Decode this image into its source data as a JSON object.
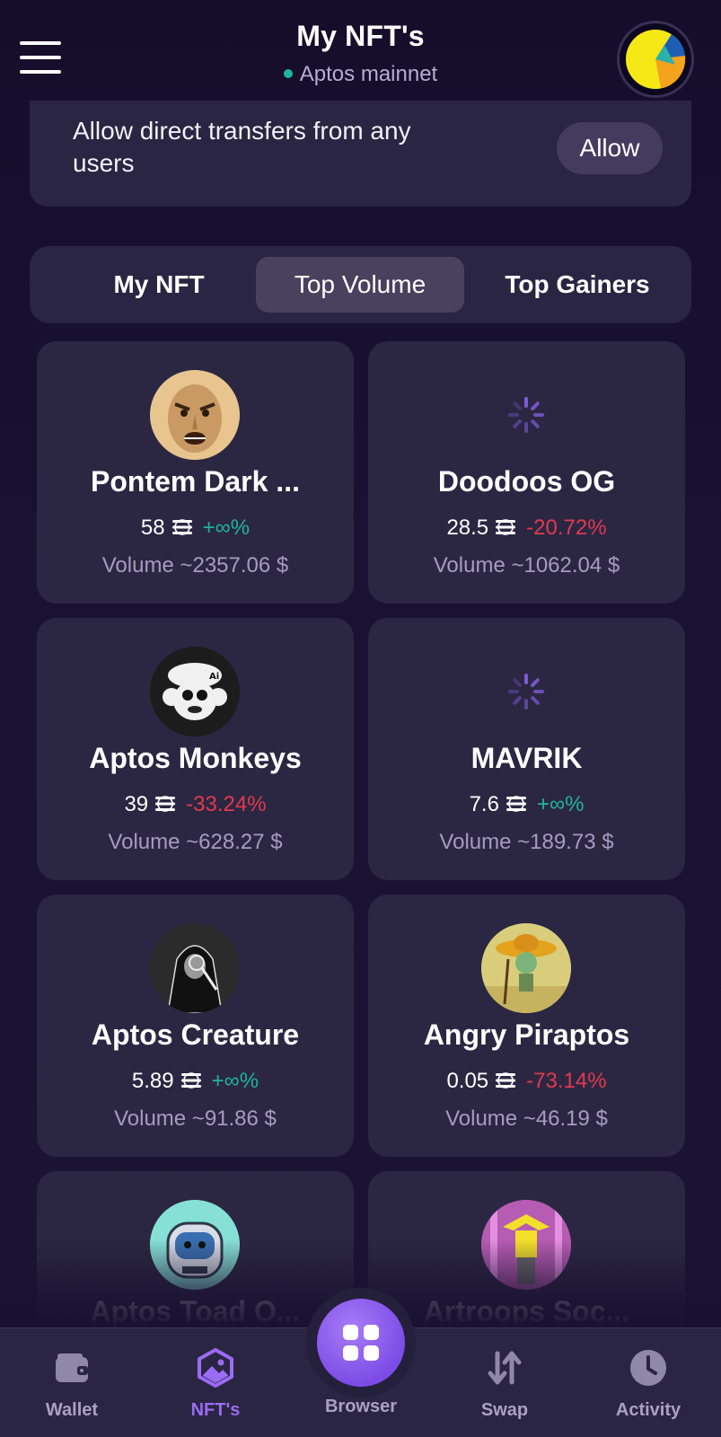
{
  "header": {
    "title": "My NFT's",
    "network": "Aptos mainnet"
  },
  "banner": {
    "text": "Allow direct transfers from any users",
    "button_label": "Allow"
  },
  "tabs": [
    {
      "label": "My NFT",
      "active": false
    },
    {
      "label": "Top Volume",
      "active": true
    },
    {
      "label": "Top Gainers",
      "active": false
    }
  ],
  "nfts": [
    {
      "name": "Pontem Dark ...",
      "price": "58",
      "change": "+∞%",
      "trend": "up",
      "volume_label": "Volume ~",
      "volume": "2357.06",
      "currency": "$",
      "image": "angry-face-avatar"
    },
    {
      "name": "Doodoos OG",
      "price": "28.5",
      "change": "-20.72%",
      "trend": "down",
      "volume_label": "Volume ~",
      "volume": "1062.04",
      "currency": "$",
      "image": "loading-spinner-icon"
    },
    {
      "name": "Aptos Monkeys",
      "price": "39",
      "change": "-33.24%",
      "trend": "down",
      "volume_label": "Volume ~",
      "volume": "628.27",
      "currency": "$",
      "image": "monkey-avatar"
    },
    {
      "name": "MAVRIK",
      "price": "7.6",
      "change": "+∞%",
      "trend": "up",
      "volume_label": "Volume ~",
      "volume": "189.73",
      "currency": "$",
      "image": "loading-spinner-icon"
    },
    {
      "name": "Aptos Creature",
      "price": "5.89",
      "change": "+∞%",
      "trend": "up",
      "volume_label": "Volume ~",
      "volume": "91.86",
      "currency": "$",
      "image": "hooded-creature-avatar"
    },
    {
      "name": "Angry Piraptos",
      "price": "0.05",
      "change": "-73.14%",
      "trend": "down",
      "volume_label": "Volume ~",
      "volume": "46.19",
      "currency": "$",
      "image": "pirate-avatar"
    },
    {
      "name": "Aptos Toad O...",
      "image": "toad-astronaut-avatar"
    },
    {
      "name": "Artroops Soc...",
      "image": "artroops-avatar"
    }
  ],
  "nav": [
    {
      "label": "Wallet",
      "icon": "wallet-icon",
      "active": false
    },
    {
      "label": "NFT's",
      "icon": "nft-image-icon",
      "active": true
    },
    {
      "label": "Browser",
      "icon": "apps-grid-icon",
      "active": false
    },
    {
      "label": "Swap",
      "icon": "swap-arrows-icon",
      "active": false
    },
    {
      "label": "Activity",
      "icon": "clock-icon",
      "active": false
    }
  ],
  "colors": {
    "background": "#1a1130",
    "card": "#2b2742",
    "accent": "#9a6cf4",
    "positive": "#1fb59b",
    "negative": "#e2394f"
  }
}
